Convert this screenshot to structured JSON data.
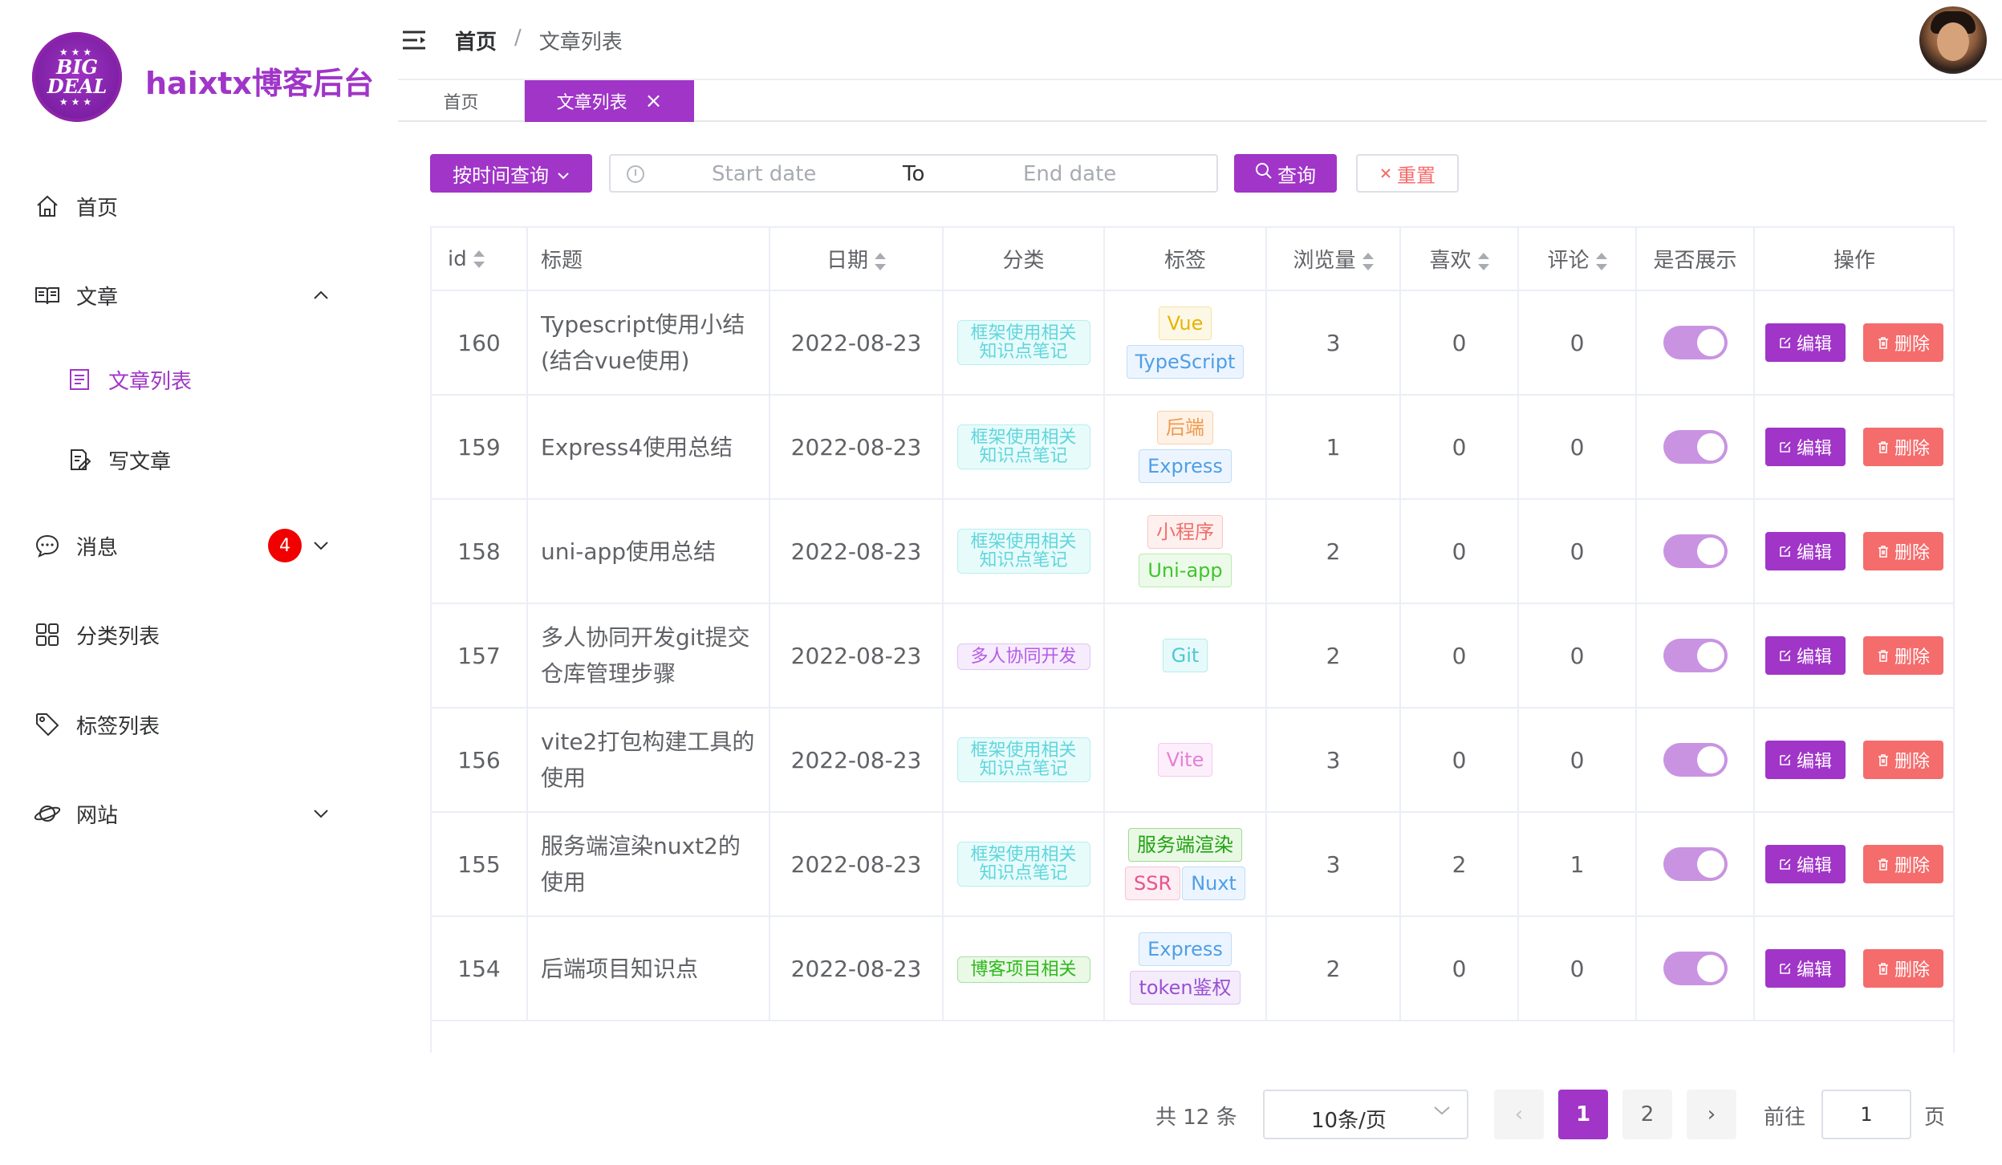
{
  "brand": {
    "title": "haixtx博客后台",
    "logo_top": "★★★",
    "logo_line1": "BIG",
    "logo_line2": "DEAL",
    "logo_bottom": "★★★"
  },
  "sidebar": {
    "items": [
      {
        "label": "首页",
        "icon": "home-icon"
      },
      {
        "label": "文章",
        "icon": "book-icon",
        "expanded": true
      },
      {
        "label": "文章列表",
        "icon": "document-list-icon",
        "active": true
      },
      {
        "label": "写文章",
        "icon": "edit-document-icon"
      },
      {
        "label": "消息",
        "icon": "chat-icon",
        "badge": "4"
      },
      {
        "label": "分类列表",
        "icon": "grid-icon"
      },
      {
        "label": "标签列表",
        "icon": "tag-icon"
      },
      {
        "label": "网站",
        "icon": "planet-icon"
      }
    ]
  },
  "header": {
    "breadcrumb": [
      "首页",
      "文章列表"
    ],
    "separator": "/"
  },
  "tabs": {
    "home": "首页",
    "active": "文章列表",
    "close": "×"
  },
  "filters": {
    "dropdown_label": "按时间查询",
    "start_placeholder": "Start date",
    "to": "To",
    "end_placeholder": "End date",
    "query_label": "查询",
    "reset_label": "重置"
  },
  "table": {
    "columns": [
      "id",
      "标题",
      "日期",
      "分类",
      "标签",
      "浏览量",
      "喜欢",
      "评论",
      "是否展示",
      "操作"
    ],
    "edit_label": "编辑",
    "delete_label": "删除",
    "rows": [
      {
        "id": "160",
        "title": "Typescript使用小结(结合vue使用)",
        "date": "2022-08-23",
        "category": "框架使用相关知识点笔记",
        "tags": [
          "Vue",
          "TypeScript"
        ],
        "views": "3",
        "likes": "0",
        "comments": "0",
        "show": true
      },
      {
        "id": "159",
        "title": "Express4使用总结",
        "date": "2022-08-23",
        "category": "框架使用相关知识点笔记",
        "tags": [
          "后端",
          "Express"
        ],
        "views": "1",
        "likes": "0",
        "comments": "0",
        "show": true
      },
      {
        "id": "158",
        "title": "uni-app使用总结",
        "date": "2022-08-23",
        "category": "框架使用相关知识点笔记",
        "tags": [
          "小程序",
          "Uni-app"
        ],
        "views": "2",
        "likes": "0",
        "comments": "0",
        "show": true
      },
      {
        "id": "157",
        "title": "多人协同开发git提交仓库管理步骤",
        "date": "2022-08-23",
        "category": "多人协同开发",
        "tags": [
          "Git"
        ],
        "views": "2",
        "likes": "0",
        "comments": "0",
        "show": true
      },
      {
        "id": "156",
        "title": "vite2打包构建工具的使用",
        "date": "2022-08-23",
        "category": "框架使用相关知识点笔记",
        "tags": [
          "Vite"
        ],
        "views": "3",
        "likes": "0",
        "comments": "0",
        "show": true
      },
      {
        "id": "155",
        "title": "服务端渲染nuxt2的使用",
        "date": "2022-08-23",
        "category": "框架使用相关知识点笔记",
        "tags": [
          "服务端渲染",
          "SSR",
          "Nuxt"
        ],
        "views": "3",
        "likes": "2",
        "comments": "1",
        "show": true
      },
      {
        "id": "154",
        "title": "后端项目知识点",
        "date": "2022-08-23",
        "category": "博客项目相关",
        "tags": [
          "Express",
          "token鉴权"
        ],
        "views": "2",
        "likes": "0",
        "comments": "0",
        "show": true
      }
    ]
  },
  "pagination": {
    "total_text": "共 12 条",
    "page_size": "10条/页",
    "pages": [
      "1",
      "2"
    ],
    "current": "1",
    "prev": "‹",
    "next": "›",
    "goto_label": "前往",
    "goto_value": "1",
    "goto_unit": "页"
  },
  "colors": {
    "accent": "#a035c8",
    "danger": "#f56c6c",
    "switch_on": "#c993e2",
    "badge": "#f20000"
  }
}
